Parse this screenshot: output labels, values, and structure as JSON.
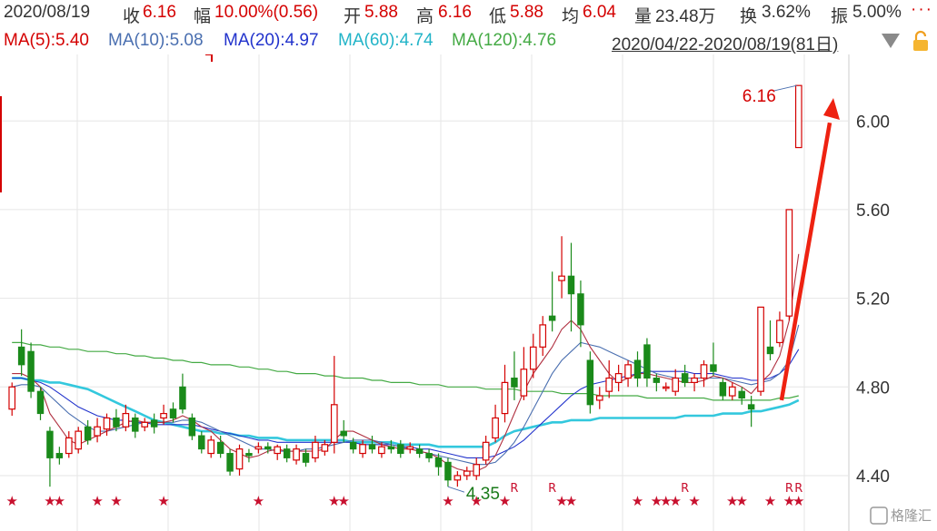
{
  "header": {
    "date": "2020/08/19",
    "close_label": "收",
    "close": "6.16",
    "change_label": "幅",
    "change": "10.00%(0.56)",
    "open_label": "开",
    "open": "5.88",
    "high_label": "高",
    "high": "6.16",
    "low_label": "低",
    "low": "5.88",
    "avg_label": "均",
    "avg": "6.04",
    "volume_label": "量",
    "volume": "23.48万",
    "turnover_label": "换",
    "turnover": "3.62%",
    "amplitude_label": "振",
    "amplitude": "5.00%",
    "more": "···"
  },
  "ma_row": {
    "ma5": "MA(5):5.40",
    "ma10": "MA(10):5.08",
    "ma20": "MA(20):4.97",
    "ma60": "MA(60):4.74",
    "ma120": "MA(120):4.76",
    "range": "2020/04/22-2020/08/19(81日)",
    "dropdown_icon": "caret-down-icon",
    "lock_icon": "unlock-icon"
  },
  "colors": {
    "up": "#d40000",
    "down": "#1a8a1a",
    "ma5": "#b03040",
    "ma10": "#4a6fb0",
    "ma20": "#2233cc",
    "ma60": "#33c8dd",
    "ma120": "#44aa44",
    "arrow": "#ee2211"
  },
  "chart_data": {
    "type": "candlestick",
    "ylim": [
      4.15,
      6.3
    ],
    "ticks": [
      "6.00",
      "5.60",
      "5.20",
      "4.80",
      "4.40"
    ],
    "high_label": "6.16",
    "low_label": "4.35",
    "watermark": "格隆汇",
    "candles": [
      [
        4.7,
        4.8,
        4.82,
        4.67
      ],
      [
        4.98,
        4.9,
        5.06,
        4.85
      ],
      [
        4.96,
        4.78,
        5.0,
        4.75
      ],
      [
        4.78,
        4.68,
        4.8,
        4.65
      ],
      [
        4.6,
        4.48,
        4.62,
        4.35
      ],
      [
        4.5,
        4.48,
        4.53,
        4.45
      ],
      [
        4.5,
        4.57,
        4.6,
        4.48
      ],
      [
        4.52,
        4.6,
        4.62,
        4.5
      ],
      [
        4.62,
        4.56,
        4.65,
        4.54
      ],
      [
        4.58,
        4.62,
        4.66,
        4.55
      ],
      [
        4.61,
        4.66,
        4.68,
        4.58
      ],
      [
        4.66,
        4.62,
        4.7,
        4.6
      ],
      [
        4.62,
        4.68,
        4.72,
        4.6
      ],
      [
        4.66,
        4.6,
        4.68,
        4.57
      ],
      [
        4.62,
        4.64,
        4.66,
        4.6
      ],
      [
        4.65,
        4.62,
        4.68,
        4.59
      ],
      [
        4.66,
        4.68,
        4.72,
        4.63
      ],
      [
        4.7,
        4.66,
        4.73,
        4.64
      ],
      [
        4.8,
        4.7,
        4.86,
        4.68
      ],
      [
        4.66,
        4.58,
        4.68,
        4.56
      ],
      [
        4.58,
        4.52,
        4.6,
        4.5
      ],
      [
        4.5,
        4.56,
        4.58,
        4.48
      ],
      [
        4.55,
        4.5,
        4.58,
        4.48
      ],
      [
        4.5,
        4.42,
        4.52,
        4.4
      ],
      [
        4.43,
        4.52,
        4.54,
        4.4
      ],
      [
        4.5,
        4.49,
        4.52,
        4.46
      ],
      [
        4.52,
        4.53,
        4.55,
        4.5
      ],
      [
        4.53,
        4.52,
        4.55,
        4.5
      ],
      [
        4.5,
        4.53,
        4.54,
        4.47
      ],
      [
        4.52,
        4.48,
        4.54,
        4.46
      ],
      [
        4.47,
        4.52,
        4.54,
        4.45
      ],
      [
        4.5,
        4.46,
        4.52,
        4.44
      ],
      [
        4.48,
        4.55,
        4.58,
        4.46
      ],
      [
        4.51,
        4.54,
        4.56,
        4.49
      ],
      [
        4.55,
        4.72,
        4.94,
        4.5
      ],
      [
        4.6,
        4.58,
        4.65,
        4.55
      ],
      [
        4.55,
        4.52,
        4.57,
        4.5
      ],
      [
        4.5,
        4.54,
        4.56,
        4.48
      ],
      [
        4.54,
        4.52,
        4.58,
        4.5
      ],
      [
        4.5,
        4.53,
        4.55,
        4.48
      ],
      [
        4.53,
        4.52,
        4.56,
        4.5
      ],
      [
        4.54,
        4.5,
        4.56,
        4.48
      ],
      [
        4.52,
        4.53,
        4.55,
        4.5
      ],
      [
        4.52,
        4.5,
        4.54,
        4.48
      ],
      [
        4.5,
        4.48,
        4.52,
        4.46
      ],
      [
        4.48,
        4.44,
        4.5,
        4.4
      ],
      [
        4.46,
        4.38,
        4.48,
        4.35
      ],
      [
        4.38,
        4.4,
        4.42,
        4.35
      ],
      [
        4.4,
        4.42,
        4.44,
        4.38
      ],
      [
        4.4,
        4.45,
        4.48,
        4.38
      ],
      [
        4.47,
        4.55,
        4.58,
        4.45
      ],
      [
        4.57,
        4.66,
        4.72,
        4.55
      ],
      [
        4.68,
        4.82,
        4.9,
        4.64
      ],
      [
        4.84,
        4.8,
        4.96,
        4.74
      ],
      [
        4.76,
        4.88,
        4.98,
        4.74
      ],
      [
        4.88,
        4.98,
        5.04,
        4.84
      ],
      [
        4.98,
        5.08,
        5.12,
        4.94
      ],
      [
        5.12,
        5.1,
        5.32,
        5.05
      ],
      [
        5.28,
        5.3,
        5.48,
        5.2
      ],
      [
        5.3,
        5.22,
        5.45,
        5.05
      ],
      [
        5.22,
        5.08,
        5.28,
        4.98
      ],
      [
        4.92,
        4.72,
        4.96,
        4.68
      ],
      [
        4.74,
        4.76,
        4.8,
        4.7
      ],
      [
        4.78,
        4.84,
        4.92,
        4.75
      ],
      [
        4.82,
        4.86,
        4.9,
        4.78
      ],
      [
        4.84,
        4.9,
        4.92,
        4.8
      ],
      [
        4.92,
        4.84,
        4.96,
        4.8
      ],
      [
        4.99,
        4.84,
        5.02,
        4.8
      ],
      [
        4.84,
        4.82,
        4.86,
        4.78
      ],
      [
        4.8,
        4.8,
        4.82,
        4.78
      ],
      [
        4.78,
        4.84,
        4.88,
        4.76
      ],
      [
        4.86,
        4.82,
        4.9,
        4.8
      ],
      [
        4.82,
        4.84,
        4.86,
        4.78
      ],
      [
        4.84,
        4.9,
        4.92,
        4.8
      ],
      [
        4.9,
        4.87,
        5.0,
        4.85
      ],
      [
        4.82,
        4.76,
        4.84,
        4.74
      ],
      [
        4.76,
        4.8,
        4.82,
        4.74
      ],
      [
        4.78,
        4.75,
        4.8,
        4.72
      ],
      [
        4.72,
        4.7,
        4.76,
        4.62
      ],
      [
        4.78,
        5.16,
        5.16,
        4.76
      ],
      [
        4.98,
        4.95,
        5.1,
        4.92
      ],
      [
        5.0,
        5.1,
        5.14,
        4.98
      ],
      [
        5.12,
        5.6,
        5.6,
        5.1
      ],
      [
        5.88,
        6.16,
        6.16,
        5.88
      ]
    ],
    "ma5": [
      4.86,
      4.86,
      4.84,
      4.8,
      4.68,
      4.62,
      4.56,
      4.54,
      4.56,
      4.58,
      4.6,
      4.62,
      4.64,
      4.65,
      4.64,
      4.64,
      4.64,
      4.65,
      4.67,
      4.65,
      4.62,
      4.6,
      4.56,
      4.52,
      4.5,
      4.48,
      4.49,
      4.51,
      4.52,
      4.51,
      4.51,
      4.51,
      4.51,
      4.52,
      4.56,
      4.6,
      4.6,
      4.58,
      4.56,
      4.54,
      4.53,
      4.52,
      4.52,
      4.51,
      4.5,
      4.48,
      4.45,
      4.43,
      4.42,
      4.42,
      4.44,
      4.49,
      4.58,
      4.68,
      4.78,
      4.86,
      4.92,
      4.98,
      5.06,
      5.1,
      5.06,
      4.98,
      4.92,
      4.86,
      4.82,
      4.84,
      4.86,
      4.86,
      4.85,
      4.84,
      4.83,
      4.82,
      4.82,
      4.83,
      4.85,
      4.84,
      4.82,
      4.8,
      4.77,
      4.82,
      4.86,
      4.94,
      5.1,
      5.4
    ],
    "ma10": [
      4.8,
      4.81,
      4.81,
      4.8,
      4.76,
      4.72,
      4.68,
      4.65,
      4.62,
      4.6,
      4.6,
      4.61,
      4.62,
      4.63,
      4.64,
      4.64,
      4.64,
      4.64,
      4.65,
      4.65,
      4.64,
      4.62,
      4.6,
      4.58,
      4.56,
      4.54,
      4.52,
      4.52,
      4.51,
      4.51,
      4.51,
      4.52,
      4.52,
      4.53,
      4.54,
      4.55,
      4.56,
      4.56,
      4.56,
      4.55,
      4.54,
      4.53,
      4.52,
      4.51,
      4.5,
      4.49,
      4.48,
      4.47,
      4.46,
      4.45,
      4.45,
      4.46,
      4.5,
      4.55,
      4.62,
      4.7,
      4.78,
      4.86,
      4.92,
      4.96,
      5.0,
      4.99,
      4.98,
      4.96,
      4.94,
      4.92,
      4.9,
      4.88,
      4.86,
      4.85,
      4.84,
      4.84,
      4.84,
      4.84,
      4.84,
      4.84,
      4.83,
      4.82,
      4.81,
      4.82,
      4.83,
      4.86,
      4.92,
      5.08
    ],
    "ma20": [
      4.84,
      4.84,
      4.83,
      4.82,
      4.8,
      4.77,
      4.74,
      4.71,
      4.69,
      4.67,
      4.66,
      4.65,
      4.65,
      4.64,
      4.64,
      4.63,
      4.63,
      4.63,
      4.63,
      4.63,
      4.62,
      4.61,
      4.6,
      4.59,
      4.58,
      4.57,
      4.56,
      4.56,
      4.55,
      4.55,
      4.55,
      4.55,
      4.55,
      4.55,
      4.55,
      4.55,
      4.55,
      4.54,
      4.54,
      4.54,
      4.54,
      4.53,
      4.53,
      4.52,
      4.52,
      4.51,
      4.5,
      4.49,
      4.48,
      4.48,
      4.48,
      4.49,
      4.51,
      4.53,
      4.56,
      4.6,
      4.64,
      4.68,
      4.72,
      4.76,
      4.79,
      4.81,
      4.82,
      4.83,
      4.84,
      4.85,
      4.86,
      4.87,
      4.87,
      4.87,
      4.87,
      4.87,
      4.86,
      4.86,
      4.86,
      4.85,
      4.84,
      4.84,
      4.83,
      4.83,
      4.84,
      4.86,
      4.9,
      4.97
    ],
    "ma60": [
      4.84,
      4.84,
      4.83,
      4.83,
      4.82,
      4.82,
      4.81,
      4.8,
      4.79,
      4.77,
      4.75,
      4.73,
      4.71,
      4.69,
      4.67,
      4.65,
      4.64,
      4.63,
      4.62,
      4.61,
      4.6,
      4.6,
      4.59,
      4.59,
      4.58,
      4.58,
      4.57,
      4.57,
      4.57,
      4.56,
      4.56,
      4.56,
      4.56,
      4.56,
      4.56,
      4.56,
      4.55,
      4.55,
      4.55,
      4.55,
      4.55,
      4.54,
      4.54,
      4.54,
      4.54,
      4.53,
      4.53,
      4.53,
      4.53,
      4.53,
      4.53,
      4.55,
      4.58,
      4.6,
      4.61,
      4.62,
      4.63,
      4.64,
      4.64,
      4.65,
      4.65,
      4.65,
      4.66,
      4.66,
      4.66,
      4.66,
      4.66,
      4.66,
      4.66,
      4.66,
      4.66,
      4.67,
      4.67,
      4.67,
      4.67,
      4.68,
      4.68,
      4.68,
      4.69,
      4.69,
      4.7,
      4.71,
      4.72,
      4.74
    ],
    "ma120": [
      5.0,
      5.0,
      4.99,
      4.99,
      4.98,
      4.98,
      4.97,
      4.97,
      4.96,
      4.96,
      4.96,
      4.95,
      4.95,
      4.94,
      4.94,
      4.93,
      4.93,
      4.92,
      4.92,
      4.91,
      4.91,
      4.9,
      4.9,
      4.9,
      4.89,
      4.89,
      4.88,
      4.88,
      4.87,
      4.87,
      4.86,
      4.86,
      4.86,
      4.85,
      4.85,
      4.84,
      4.84,
      4.84,
      4.83,
      4.83,
      4.82,
      4.82,
      4.82,
      4.81,
      4.81,
      4.81,
      4.8,
      4.8,
      4.8,
      4.8,
      4.79,
      4.79,
      4.79,
      4.79,
      4.78,
      4.78,
      4.78,
      4.78,
      4.77,
      4.77,
      4.77,
      4.77,
      4.76,
      4.76,
      4.76,
      4.76,
      4.76,
      4.75,
      4.75,
      4.75,
      4.75,
      4.75,
      4.75,
      4.75,
      4.74,
      4.74,
      4.74,
      4.74,
      4.74,
      4.74,
      4.74,
      4.75,
      4.75,
      4.76
    ],
    "markers": [
      {
        "i": 0,
        "t": "★"
      },
      {
        "i": 4,
        "t": "★"
      },
      {
        "i": 5,
        "t": "★"
      },
      {
        "i": 9,
        "t": "★"
      },
      {
        "i": 11,
        "t": "★"
      },
      {
        "i": 16,
        "t": "★"
      },
      {
        "i": 26,
        "t": "★"
      },
      {
        "i": 34,
        "t": "★"
      },
      {
        "i": 35,
        "t": "★"
      },
      {
        "i": 46,
        "t": "★"
      },
      {
        "i": 49,
        "t": "★"
      },
      {
        "i": 52,
        "t": "★"
      },
      {
        "i": 53,
        "t": "R"
      },
      {
        "i": 57,
        "t": "R"
      },
      {
        "i": 58,
        "t": "★"
      },
      {
        "i": 59,
        "t": "★"
      },
      {
        "i": 66,
        "t": "★"
      },
      {
        "i": 68,
        "t": "★"
      },
      {
        "i": 69,
        "t": "★"
      },
      {
        "i": 70,
        "t": "★"
      },
      {
        "i": 71,
        "t": "R"
      },
      {
        "i": 72,
        "t": "★"
      },
      {
        "i": 76,
        "t": "★"
      },
      {
        "i": 77,
        "t": "★"
      },
      {
        "i": 80,
        "t": "★"
      },
      {
        "i": 82,
        "t": "R"
      },
      {
        "i": 83,
        "t": "R"
      },
      {
        "i": 82,
        "t": "★"
      },
      {
        "i": 83,
        "t": "★"
      }
    ]
  }
}
